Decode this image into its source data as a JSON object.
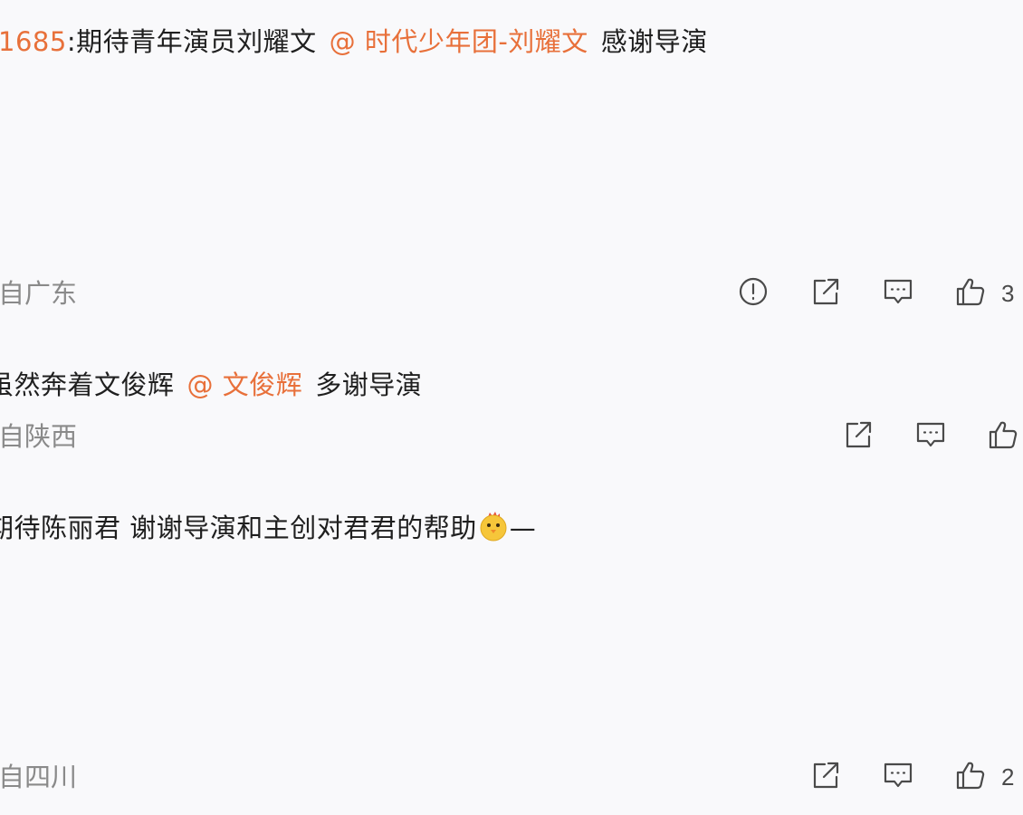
{
  "comments": [
    {
      "prefix": "1685",
      "colon": ":",
      "text": "期待青年演员刘耀文",
      "mention": "@ 时代少年团-刘耀文",
      "suffix": "感谢导演",
      "location": "自广东",
      "like_count": "3"
    },
    {
      "text": "虽然奔着文俊辉",
      "mention": "@ 文俊辉",
      "suffix": "多谢导演",
      "location": "自陕西",
      "like_count": ""
    },
    {
      "text": "期待陈丽君 谢谢导演和主创对君君的帮助",
      "suffix": "—",
      "location": "自四川",
      "like_count": "2"
    }
  ],
  "icons": {
    "report": "exclamation-circle-icon",
    "share": "share-icon",
    "comment": "comment-icon",
    "like": "thumbs-up-icon",
    "emoji": "chick-emoji-icon"
  },
  "colors": {
    "accent": "#e8703a",
    "text": "#1f1f1f",
    "meta": "#8a8a8a",
    "icon": "#4a4a4a",
    "background": "#f9f9fb"
  }
}
